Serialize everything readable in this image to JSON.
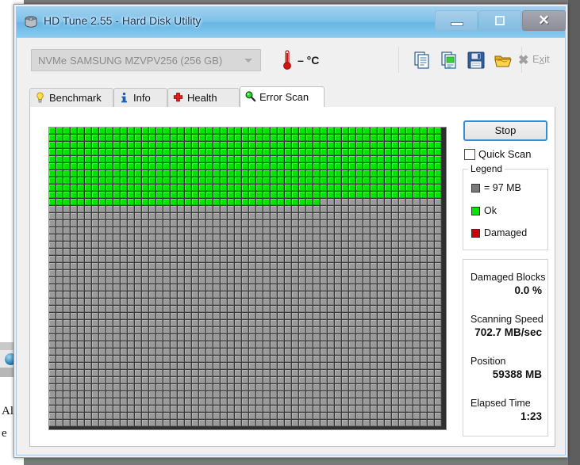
{
  "background": {
    "text_fragment_1": "Al",
    "text_fragment_2": "e",
    "globe_icon": "globe-icon"
  },
  "window": {
    "title": "HD Tune 2.55 - Hard Disk Utility",
    "icon": "hard-disk-icon",
    "controls": {
      "minimize": "minimize-icon",
      "maximize": "maximize-icon",
      "close": "close-icon"
    }
  },
  "toolbar": {
    "drive": {
      "type": "NVMe",
      "name": "SAMSUNG MZVPV256 (256 GB)",
      "arrow_icon": "chevron-down-icon"
    },
    "temperature": {
      "icon": "thermometer-icon",
      "value": "– °C"
    },
    "icons": [
      {
        "name": "copy-icon"
      },
      {
        "name": "copy-screenshot-icon"
      },
      {
        "name": "save-icon"
      },
      {
        "name": "folder-open-icon"
      }
    ],
    "exit": {
      "label_pre": "E",
      "label_mnemonic": "x",
      "label_post": "it",
      "icon": "close-x-icon"
    }
  },
  "tabs": [
    {
      "label": "Benchmark",
      "icon": "bulb-icon",
      "active": false
    },
    {
      "label": "Info",
      "icon": "info-icon",
      "active": false
    },
    {
      "label": "Health",
      "icon": "health-cross-icon",
      "active": false
    },
    {
      "label": "Error Scan",
      "icon": "magnifier-icon",
      "active": true
    }
  ],
  "side_panel": {
    "stop_button": "Stop",
    "quick_scan": {
      "label": "Quick Scan",
      "checked": false
    },
    "legend": {
      "title": "Legend",
      "rows": [
        {
          "swatch": "#7a7a7a",
          "text": "= 97 MB"
        },
        {
          "swatch": "#00e500",
          "text": "Ok"
        },
        {
          "swatch": "#cc0000",
          "text": "Damaged"
        }
      ]
    },
    "stats": [
      {
        "label": "Damaged Blocks",
        "value": "0.0 %"
      },
      {
        "label": "Scanning Speed",
        "value": "702.7 MB/sec"
      },
      {
        "label": "Position",
        "value": "59388 MB"
      },
      {
        "label": "Elapsed Time",
        "value": "1:23"
      }
    ]
  },
  "chart_data": {
    "type": "heatmap",
    "title": "Error Scan block map",
    "columns": 55,
    "rows": 42,
    "block_size_mb": 97,
    "scanned_cells": 588,
    "colors": {
      "ok": "#00e500",
      "unscanned": "#9a9a9a",
      "damaged": "#cc0000"
    },
    "legend": [
      "= 97 MB",
      "Ok",
      "Damaged"
    ],
    "damaged_blocks_percent": 0.0,
    "position_mb": 59388,
    "scanning_speed_mb_per_sec": 702.7,
    "elapsed_time": "1:23"
  }
}
